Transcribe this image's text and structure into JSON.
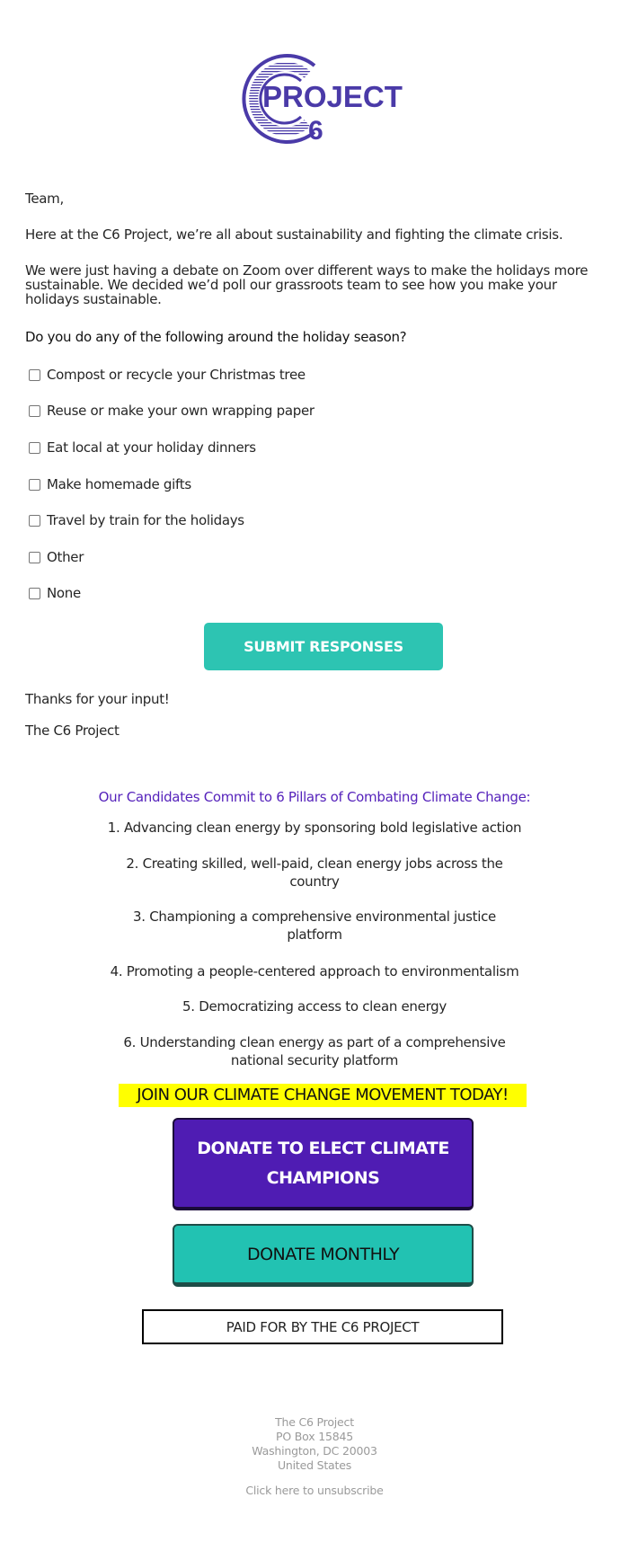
{
  "logo": {
    "letter": "C",
    "word": "PROJECT",
    "number": "6",
    "color": "#4a3aa8"
  },
  "greeting": "Team,",
  "intro": "Here at the C6 Project, we’re all about sustainability and fighting the climate crisis.",
  "paragraph": "We were just having a debate on Zoom over different ways to make the holidays more sustainable. We decided we’d poll our grassroots team to see how you make your holidays sustainable.",
  "question": "Do you do any of the following around the holiday season?",
  "options": [
    {
      "label": "Compost or recycle your Christmas tree",
      "checked": false
    },
    {
      "label": "Reuse or make your own wrapping paper",
      "checked": false
    },
    {
      "label": "Eat local at your holiday dinners",
      "checked": false
    },
    {
      "label": "Make homemade gifts",
      "checked": false
    },
    {
      "label": "Travel by train for the holidays",
      "checked": false
    },
    {
      "label": "Other",
      "checked": false
    },
    {
      "label": "None",
      "checked": false
    }
  ],
  "submit_label": "SUBMIT RESPONSES",
  "thanks": "Thanks for your input!",
  "signature": "The C6 Project",
  "pillars": {
    "title": "Our Candidates Commit to 6 Pillars of Combating Climate Change:",
    "items": [
      "1. Advancing clean energy by sponsoring bold legislative action",
      "2. Creating skilled, well-paid, clean energy jobs across the country",
      "3. Championing a comprehensive environmental justice platform",
      "4. Promoting a people-centered approach to environmentalism",
      "5. Democratizing access to clean energy",
      "6. Understanding clean energy as part of a comprehensive national security platform"
    ]
  },
  "join_banner": "JOIN OUR CLIMATE CHANGE MOVEMENT TODAY!",
  "donate_label": "DONATE TO ELECT CLIMATE CHAMPIONS",
  "monthly_label": "DONATE MONTHLY",
  "paid_for": "PAID FOR BY THE C6 PROJECT",
  "footer": {
    "org": "The C6 Project",
    "po_box": "PO Box 15845",
    "city": "Washington, DC 20003",
    "country": "United States",
    "unsubscribe": "Click here to unsubscribe"
  },
  "colors": {
    "teal": "#2dc4b2",
    "purple": "#4f1cb3",
    "highlight": "#ffff00"
  }
}
